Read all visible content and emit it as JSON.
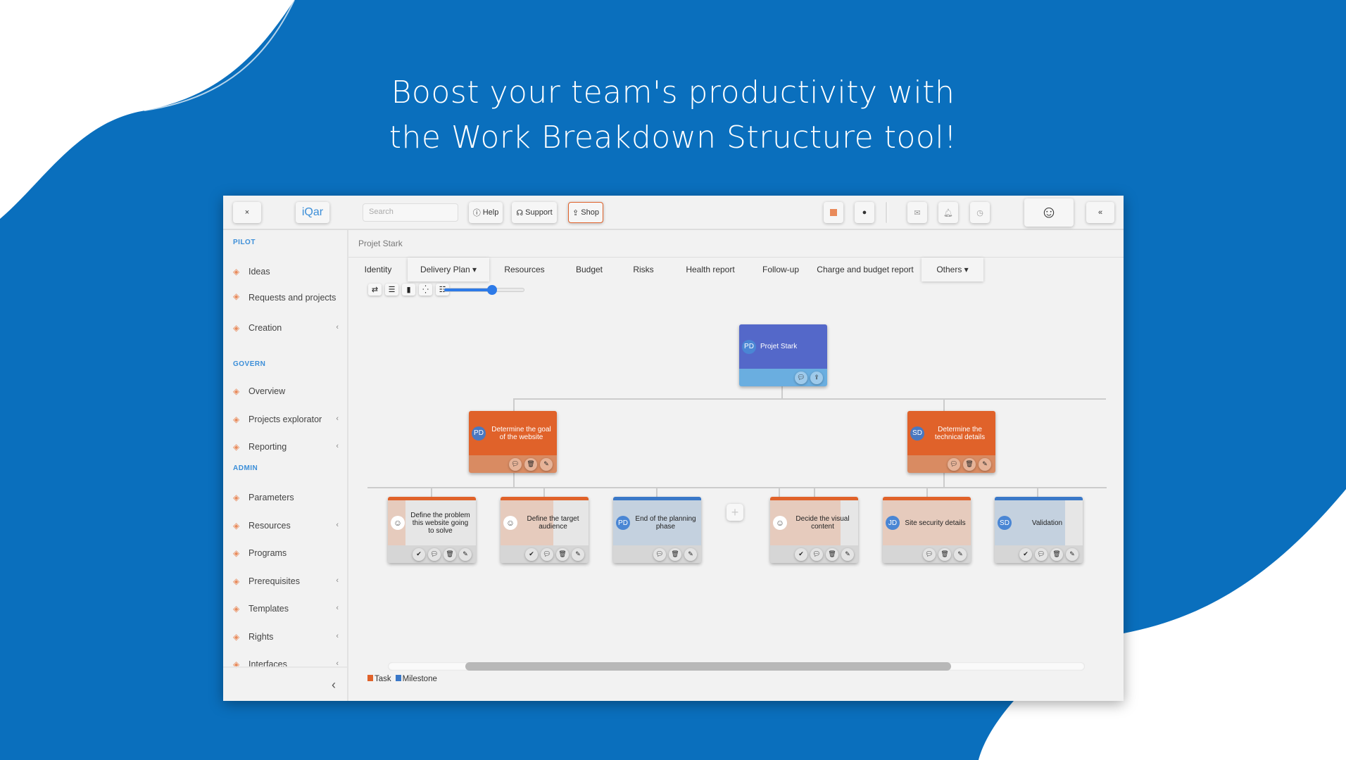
{
  "headline": {
    "line1": "Boost your team's productivity with",
    "line2": "the Work Breakdown Structure tool!"
  },
  "colors": {
    "background": "#0a6fbd",
    "task": "#e0622a",
    "milestone": "#3a78c8",
    "root": "#5468c9",
    "accent": "#3b8ed8"
  },
  "topbar": {
    "close": "×",
    "logo": "iQar",
    "search_placeholder": "Search",
    "help": "Help",
    "support": "Support",
    "shop": "Shop",
    "collapse": "«",
    "icons": [
      "flag-icon",
      "palette-icon",
      "mail-icon",
      "bell-icon",
      "clock-icon",
      "user-avatar"
    ]
  },
  "sidebar": {
    "sections": [
      {
        "title": "PILOT",
        "items": [
          {
            "label": "Ideas",
            "icon": "lightbulb-icon"
          },
          {
            "label": "Requests and projects",
            "icon": "briefcase-icon"
          },
          {
            "label": "Creation",
            "icon": "plus-icon",
            "chev": "‹"
          }
        ]
      },
      {
        "title": "GOVERN",
        "items": [
          {
            "label": "Overview",
            "icon": "list-icon"
          },
          {
            "label": "Projects explorator",
            "icon": "share-icon",
            "chev": "‹"
          },
          {
            "label": "Reporting",
            "icon": "clipboard-icon",
            "chev": "‹"
          }
        ]
      },
      {
        "title": "ADMIN",
        "items": [
          {
            "label": "Parameters",
            "icon": "gear-icon"
          },
          {
            "label": "Resources",
            "icon": "user-icon",
            "chev": "‹"
          },
          {
            "label": "Programs",
            "icon": "grid-icon"
          },
          {
            "label": "Prerequisites",
            "icon": "checklist-icon",
            "chev": "‹"
          },
          {
            "label": "Templates",
            "icon": "file-icon",
            "chev": "‹"
          },
          {
            "label": "Rights",
            "icon": "edit-icon",
            "chev": "‹"
          },
          {
            "label": "Interfaces",
            "icon": "cloud-icon",
            "chev": "‹"
          }
        ]
      }
    ],
    "collapse": "‹"
  },
  "main": {
    "breadcrumb": "Projet Stark",
    "tabs": [
      "Identity",
      "Delivery Plan ▾",
      "Resources",
      "Budget",
      "Risks",
      "Health report",
      "Follow-up",
      "Charge and budget report",
      "Others ▾"
    ],
    "zoom_level": 0.6,
    "root": {
      "initials": "PD",
      "title": "Projet Stark"
    },
    "level1": [
      {
        "initials": "PD",
        "title": "Determine the goal of the website",
        "type": "task"
      },
      {
        "initials": "SD",
        "title": "Determine the technical details",
        "type": "task"
      }
    ],
    "leaves": [
      {
        "avatar": "photo",
        "initials": "☺",
        "title": "Define the problem this website going to solve",
        "type": "task",
        "progress": 0.2,
        "check": true
      },
      {
        "avatar": "photo",
        "initials": "☺",
        "title": "Define the target audience",
        "type": "task",
        "progress": 0.6,
        "check": true
      },
      {
        "avatar": "initials",
        "initials": "PD",
        "title": "End of the planning phase",
        "type": "milestone",
        "progress": 1,
        "check": false
      },
      {
        "avatar": "photo",
        "initials": "☺",
        "title": "Decide the visual content",
        "type": "task",
        "progress": 0.8,
        "check": true
      },
      {
        "avatar": "initials",
        "initials": "JD",
        "title": "Site security details",
        "type": "task",
        "progress": 1,
        "check": false
      },
      {
        "avatar": "initials",
        "initials": "SD",
        "title": "Validation",
        "type": "milestone",
        "progress": 0.8,
        "check": true
      }
    ],
    "add": "+",
    "legend": {
      "task": "Task",
      "milestone": "Milestone"
    }
  }
}
